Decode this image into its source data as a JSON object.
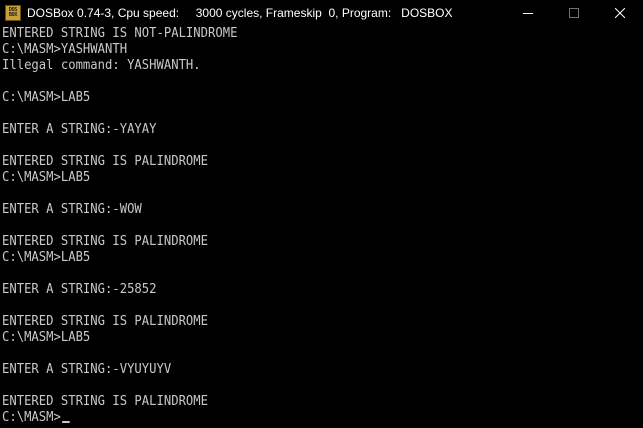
{
  "window": {
    "title": "DOSBox 0.74-3, Cpu speed:     3000 cycles, Frameskip  0, Program:   DOSBOX",
    "icon": "dosbox-icon",
    "icon_text_top": "DOS",
    "icon_text_bottom": "BOX"
  },
  "controls": {
    "minimize": "minimize-icon",
    "maximize": "maximize-icon",
    "close": "close-icon"
  },
  "console": {
    "lines": [
      "ENTERED STRING IS NOT-PALINDROME",
      "C:\\MASM>YASHWANTH",
      "Illegal command: YASHWANTH.",
      "",
      "C:\\MASM>LAB5",
      "",
      "ENTER A STRING:-YAYAY",
      "",
      "ENTERED STRING IS PALINDROME",
      "C:\\MASM>LAB5",
      "",
      "ENTER A STRING:-WOW",
      "",
      "ENTERED STRING IS PALINDROME",
      "C:\\MASM>LAB5",
      "",
      "ENTER A STRING:-25852",
      "",
      "ENTERED STRING IS PALINDROME",
      "C:\\MASM>LAB5",
      "",
      "ENTER A STRING:-VYUYUYV",
      "",
      "ENTERED STRING IS PALINDROME",
      "C:\\MASM>"
    ]
  },
  "colors": {
    "background": "#000000",
    "text": "#c8c8c8",
    "titlebar": "#000000",
    "title_text": "#ffffff"
  }
}
